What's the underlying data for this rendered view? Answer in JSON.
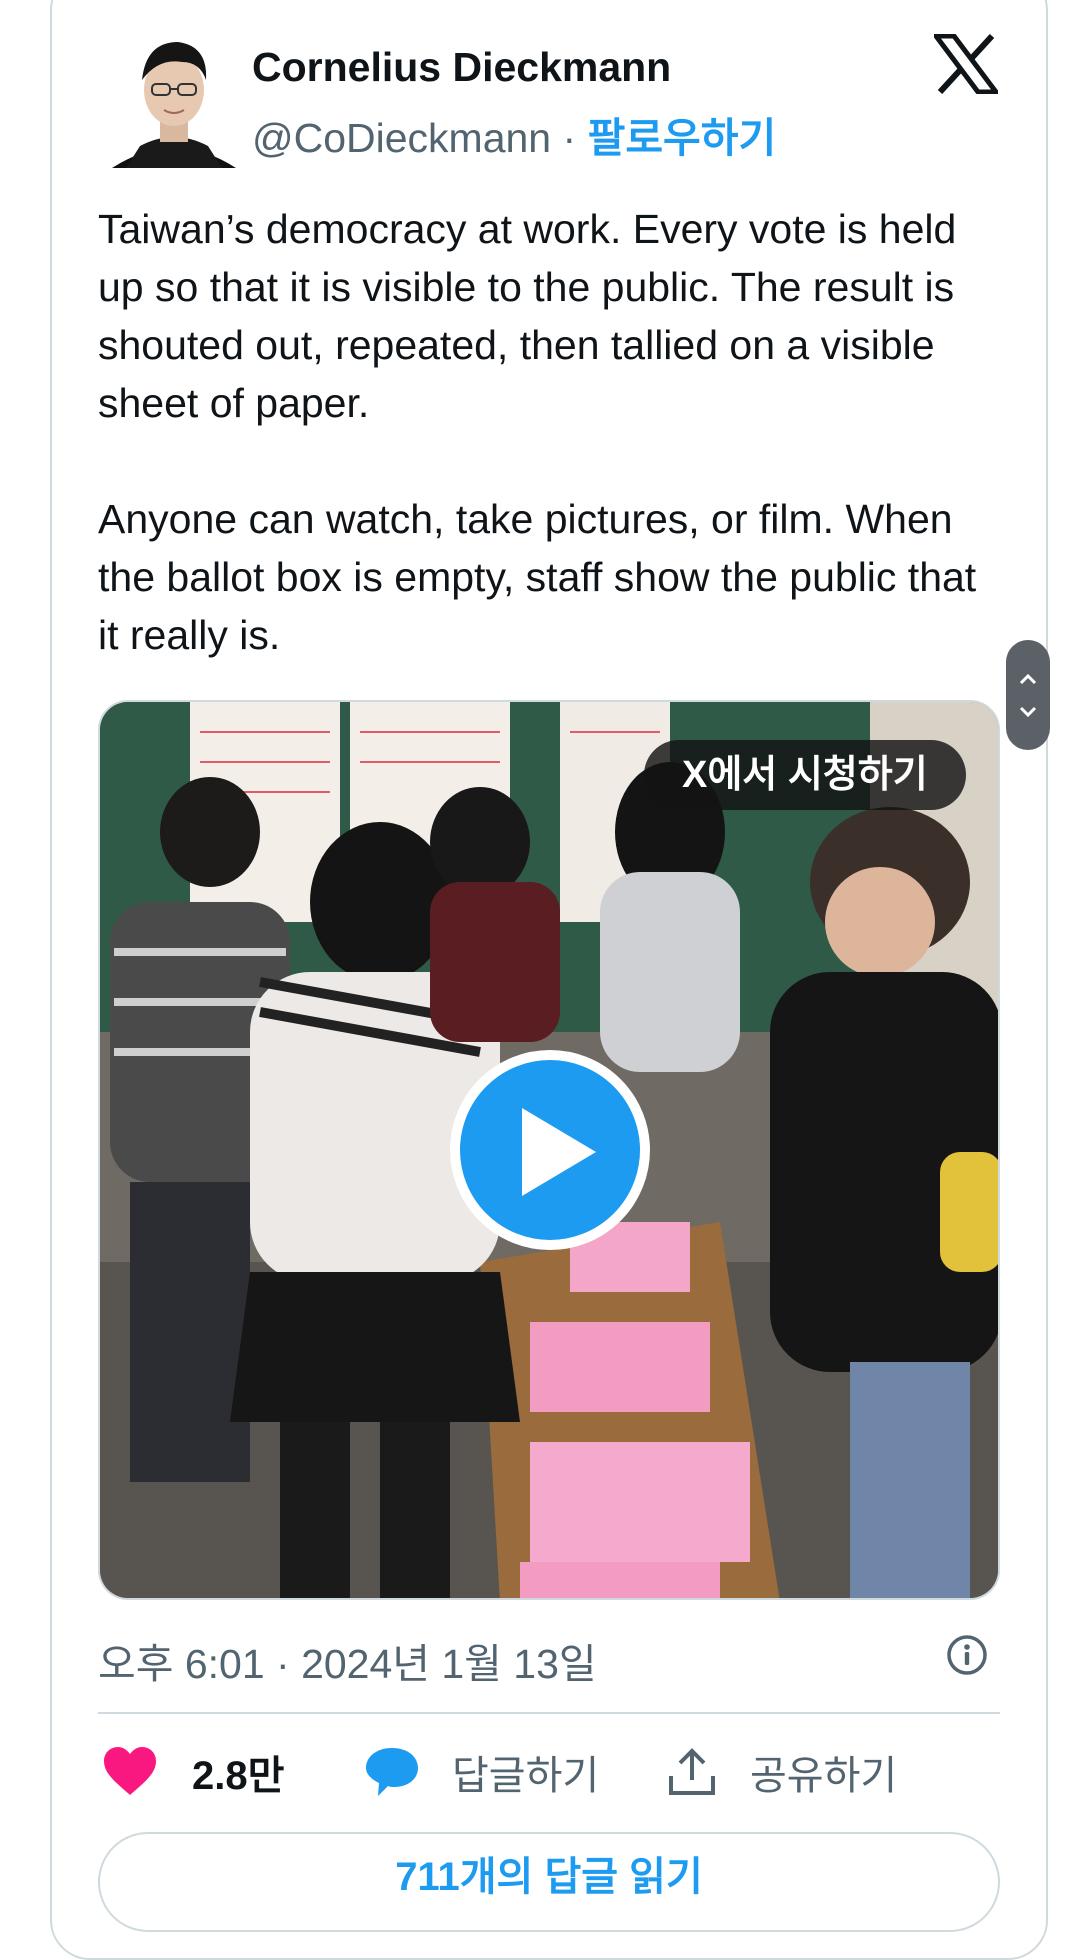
{
  "author": {
    "name": "Cornelius Dieckmann",
    "handle": "@CoDieckmann",
    "separator": "·",
    "follow_label": "팔로우하기"
  },
  "tweet": {
    "paragraphs": [
      "Taiwan’s democracy at work. Every vote is held up so that it is visible to the public. The result is shouted out, repeated, then tallied on a visible sheet of paper.",
      "Anyone can watch, take pictures, or film. When the ballot box is empty, staff show the public that it really is."
    ],
    "timestamp": "오후 6:01 · 2024년 1월 13일"
  },
  "media": {
    "watch_on_x_label": "X에서 시청하기"
  },
  "actions": {
    "likes_count": "2.8만",
    "reply_label": "답글하기",
    "share_label": "공유하기",
    "read_replies_label": "711개의 답글 읽기"
  },
  "colors": {
    "accent": "#1d9bf0",
    "like": "#f91880",
    "text_secondary": "#536471",
    "border": "#cfd9de"
  },
  "icons": [
    "x-logo-icon",
    "info-icon",
    "heart-icon",
    "reply-bubble-icon",
    "share-icon",
    "play-icon",
    "chevron-up-icon",
    "chevron-down-icon"
  ]
}
